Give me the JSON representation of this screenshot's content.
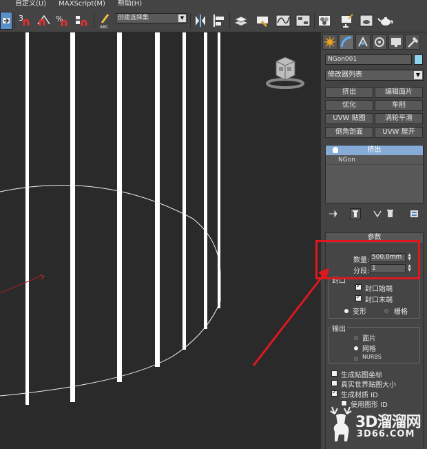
{
  "menu": [
    "自定义(U)",
    "MAXScript(M)",
    "帮助(H)"
  ],
  "toolbar": {
    "selection_set": "创建选择集",
    "abc_label": "ABC"
  },
  "panel": {
    "object_name": "NGon001",
    "object_color": "#8fd3ec",
    "modifier_list": "修改器列表",
    "buttons": [
      "挤出",
      "编辑面片",
      "优化",
      "车削",
      "UVW 贴图",
      "涡轮平滑",
      "倒角剖面",
      "UVW 展开"
    ],
    "stack": {
      "selected": "挤出",
      "base": "NGon"
    },
    "params": {
      "title": "参数",
      "amount_label": "数量:",
      "amount_value": "500.0mm",
      "segments_label": "分段:",
      "segments_value": "1",
      "cap_group": "封口",
      "cap_start": "封口始端",
      "cap_end": "封口末端",
      "morph": "变形",
      "grid": "栅格",
      "output_group": "输出",
      "patch": "面片",
      "mesh": "网格",
      "nurbs": "NURBS",
      "gen_map_coords": "生成贴图坐标",
      "real_world": "真实世界贴图大小",
      "gen_mat_id": "生成材质 ID",
      "use_shape_id": "使用图形 ID"
    }
  },
  "watermark": {
    "brand": "3D溜溜网",
    "url": "3D66.COM"
  },
  "colors": {
    "highlight": "#e0181e",
    "selected_row": "#86abd6"
  }
}
